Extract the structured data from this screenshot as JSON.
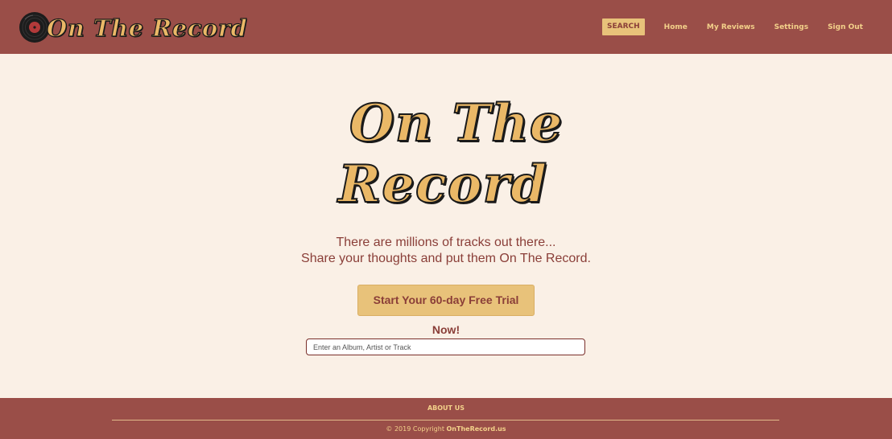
{
  "header": {
    "logo_text": "On The Record",
    "nav": {
      "search": "SEARCH",
      "home": "Home",
      "my_reviews": "My Reviews",
      "settings": "Settings",
      "sign_out": "Sign Out"
    }
  },
  "hero": {
    "logo_line1": "On The",
    "logo_line2": "Record",
    "tagline_line1": "There are millions of tracks out there...",
    "tagline_line2": "Share your thoughts and put them On The Record.",
    "cta_label": "Start Your 60-day Free Trial Now!"
  },
  "search": {
    "value": "",
    "placeholder": "Enter an Album, Artist or Track"
  },
  "footer": {
    "about": "ABOUT US",
    "copyright_prefix": "© 2019 Copyright ",
    "copyright_site": "OnTheRecord.us"
  },
  "colors": {
    "brand_red": "#9a4e48",
    "brand_gold": "#eab867",
    "background": "#faf0e6"
  },
  "icons": {
    "logo_icon": "vinyl-record-icon"
  }
}
